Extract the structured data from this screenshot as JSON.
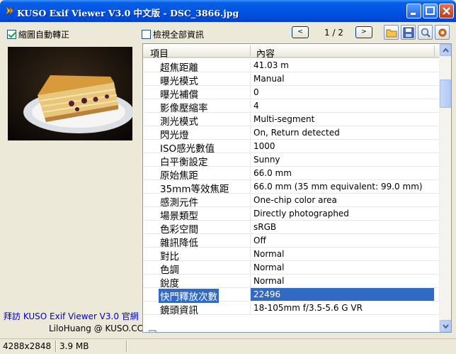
{
  "window": {
    "title": "KUSO Exif Viewer V3.0 中文版 - DSC_3866.jpg"
  },
  "left": {
    "auto_rotate_label": "縮圖自動轉正",
    "auto_rotate_checked": true,
    "link": "拜訪 KUSO Exif Viewer V3.0 官網",
    "credit": "LiloHuang @ KUSO.CC"
  },
  "toolbar": {
    "show_all_label": "檢視全部資訊",
    "show_all_checked": false,
    "prev": "<",
    "next": ">",
    "page": "1 / 2"
  },
  "table": {
    "headers": [
      "項目",
      "內容"
    ],
    "rows": [
      {
        "key": "超焦距離",
        "value": "41.03 m"
      },
      {
        "key": "曝光模式",
        "value": "Manual"
      },
      {
        "key": "曝光補償",
        "value": "0"
      },
      {
        "key": "影像壓縮率",
        "value": "4"
      },
      {
        "key": "測光模式",
        "value": "Multi-segment"
      },
      {
        "key": "閃光燈",
        "value": "On, Return detected"
      },
      {
        "key": "ISO感光數值",
        "value": "1000"
      },
      {
        "key": "白平衡設定",
        "value": "Sunny"
      },
      {
        "key": "原始焦距",
        "value": "66.0 mm"
      },
      {
        "key": "35mm等效焦距",
        "value": "66.0 mm (35 mm equivalent: 99.0 mm)"
      },
      {
        "key": "感測元件",
        "value": "One-chip color area"
      },
      {
        "key": "場景類型",
        "value": "Directly photographed"
      },
      {
        "key": "色彩空間",
        "value": "sRGB"
      },
      {
        "key": "雜訊降低",
        "value": "Off"
      },
      {
        "key": "對比",
        "value": "Normal"
      },
      {
        "key": "色調",
        "value": "Normal"
      },
      {
        "key": "銳度",
        "value": "Normal"
      },
      {
        "key": "快門釋放次數",
        "value": "22496",
        "selected": true
      },
      {
        "key": "鏡頭資訊",
        "value": "18-105mm f/3.5-5.6 G VR"
      }
    ]
  },
  "status": {
    "dimensions": "4288x2848",
    "size": "3.9 MB"
  },
  "colors": {
    "selection": "#316ac5",
    "link": "#0000c8",
    "titlebar": "#0054e3"
  }
}
